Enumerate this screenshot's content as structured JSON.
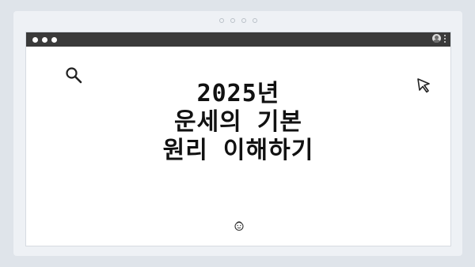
{
  "window": {
    "traffic_lights": [
      "close",
      "minimize",
      "maximize"
    ],
    "tab_indicator_count": 4,
    "titlebar_color": "#3a3a3a"
  },
  "content": {
    "title_lines": [
      "2025년",
      "운세의 기본",
      "원리 이해하기"
    ]
  },
  "icons": {
    "search": "search-icon",
    "cursor": "mouse-pointer-icon",
    "face": "smiley-face-icon",
    "avatar": "user-avatar-icon",
    "menu": "kebab-menu-icon"
  }
}
